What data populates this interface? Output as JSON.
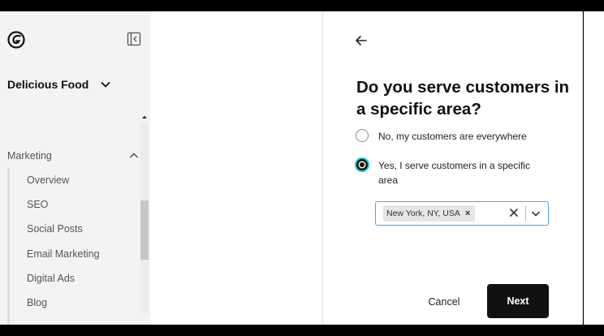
{
  "sidebar": {
    "site_name": "Delicious Food",
    "section_label": "Marketing",
    "items": [
      {
        "label": "Overview"
      },
      {
        "label": "SEO"
      },
      {
        "label": "Social Posts"
      },
      {
        "label": "Email Marketing"
      },
      {
        "label": "Digital Ads"
      },
      {
        "label": "Blog"
      }
    ]
  },
  "question": {
    "title": "Do you serve customers in a specific area?",
    "options": [
      {
        "label": "No, my customers are everywhere",
        "selected": false
      },
      {
        "label": "Yes, I serve customers in a specific area",
        "selected": true
      }
    ]
  },
  "area_select": {
    "chips": [
      {
        "label": "New York, NY, USA"
      }
    ]
  },
  "actions": {
    "cancel_label": "Cancel",
    "next_label": "Next"
  },
  "icons": {
    "logo": "godaddy-logo-icon",
    "collapse": "collapse-sidebar-icon",
    "site_chevron": "chevron-down-icon",
    "section_chevron": "chevron-up-icon",
    "back": "arrow-left-icon",
    "chip_remove": "close-icon",
    "clear": "close-icon",
    "dropdown": "chevron-down-icon"
  },
  "colors": {
    "primary_button": "#111111",
    "focus_ring": "#1ec8d0",
    "input_border": "#4aa7e0",
    "sidebar_bg": "#f3f3f3"
  }
}
